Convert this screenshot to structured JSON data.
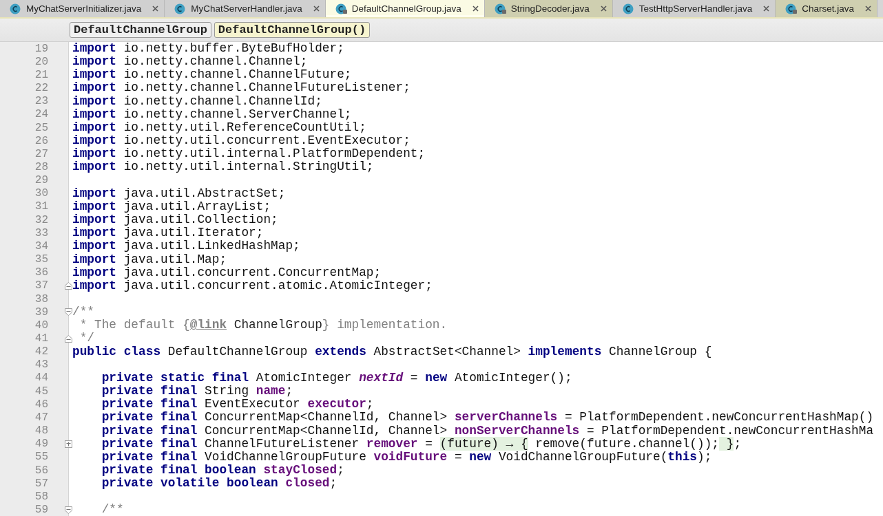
{
  "tabs": [
    {
      "label": "MyChatServerInitializer.java",
      "selected": false,
      "kind": "class",
      "color": "#d0d0d0"
    },
    {
      "label": "MyChatServerHandler.java",
      "selected": false,
      "kind": "class",
      "color": "#d0d0d0"
    },
    {
      "label": "DefaultChannelGroup.java",
      "selected": true,
      "kind": "class-locked",
      "color": "#fbfbe4"
    },
    {
      "label": "StringDecoder.java",
      "selected": false,
      "kind": "class-locked",
      "color": "#cfcfb0"
    },
    {
      "label": "TestHttpServerHandler.java",
      "selected": false,
      "kind": "class",
      "color": "#d0d0d0"
    },
    {
      "label": "Charset.java",
      "selected": false,
      "kind": "class-locked",
      "color": "#cfcfb0"
    }
  ],
  "breadcrumbs": [
    {
      "label": "DefaultChannelGroup",
      "selected": false
    },
    {
      "label": "DefaultChannelGroup()",
      "selected": true
    }
  ],
  "lines": [
    {
      "number": "19",
      "tokens": [
        {
          "kind": "keyword",
          "text": "import"
        },
        {
          "kind": "plain",
          "text": " io.netty.buffer.ByteBufHolder;"
        }
      ]
    },
    {
      "number": "20",
      "tokens": [
        {
          "kind": "keyword",
          "text": "import"
        },
        {
          "kind": "plain",
          "text": " io.netty.channel.Channel;"
        }
      ]
    },
    {
      "number": "21",
      "tokens": [
        {
          "kind": "keyword",
          "text": "import"
        },
        {
          "kind": "plain",
          "text": " io.netty.channel.ChannelFuture;"
        }
      ]
    },
    {
      "number": "22",
      "tokens": [
        {
          "kind": "keyword",
          "text": "import"
        },
        {
          "kind": "plain",
          "text": " io.netty.channel.ChannelFutureListener;"
        }
      ]
    },
    {
      "number": "23",
      "tokens": [
        {
          "kind": "keyword",
          "text": "import"
        },
        {
          "kind": "plain",
          "text": " io.netty.channel.ChannelId;"
        }
      ]
    },
    {
      "number": "24",
      "tokens": [
        {
          "kind": "keyword",
          "text": "import"
        },
        {
          "kind": "plain",
          "text": " io.netty.channel.ServerChannel;"
        }
      ]
    },
    {
      "number": "25",
      "tokens": [
        {
          "kind": "keyword",
          "text": "import"
        },
        {
          "kind": "plain",
          "text": " io.netty.util.ReferenceCountUtil;"
        }
      ]
    },
    {
      "number": "26",
      "tokens": [
        {
          "kind": "keyword",
          "text": "import"
        },
        {
          "kind": "plain",
          "text": " io.netty.util.concurrent.EventExecutor;"
        }
      ]
    },
    {
      "number": "27",
      "tokens": [
        {
          "kind": "keyword",
          "text": "import"
        },
        {
          "kind": "plain",
          "text": " io.netty.util.internal.PlatformDependent;"
        }
      ]
    },
    {
      "number": "28",
      "tokens": [
        {
          "kind": "keyword",
          "text": "import"
        },
        {
          "kind": "plain",
          "text": " io.netty.util.internal.StringUtil;"
        }
      ]
    },
    {
      "number": "29"
    },
    {
      "number": "30",
      "tokens": [
        {
          "kind": "keyword",
          "text": "import"
        },
        {
          "kind": "plain",
          "text": " java.util.AbstractSet;"
        }
      ]
    },
    {
      "number": "31",
      "tokens": [
        {
          "kind": "keyword",
          "text": "import"
        },
        {
          "kind": "plain",
          "text": " java.util.ArrayList;"
        }
      ]
    },
    {
      "number": "32",
      "tokens": [
        {
          "kind": "keyword",
          "text": "import"
        },
        {
          "kind": "plain",
          "text": " java.util.Collection;"
        }
      ]
    },
    {
      "number": "33",
      "tokens": [
        {
          "kind": "keyword",
          "text": "import"
        },
        {
          "kind": "plain",
          "text": " java.util.Iterator;"
        }
      ]
    },
    {
      "number": "34",
      "tokens": [
        {
          "kind": "keyword",
          "text": "import"
        },
        {
          "kind": "plain",
          "text": " java.util.LinkedHashMap;"
        }
      ]
    },
    {
      "number": "35",
      "tokens": [
        {
          "kind": "keyword",
          "text": "import"
        },
        {
          "kind": "plain",
          "text": " java.util.Map;"
        }
      ]
    },
    {
      "number": "36",
      "tokens": [
        {
          "kind": "keyword",
          "text": "import"
        },
        {
          "kind": "plain",
          "text": " java.util.concurrent.ConcurrentMap;"
        }
      ]
    },
    {
      "number": "37",
      "fold_end": true,
      "tokens": [
        {
          "kind": "keyword",
          "text": "import"
        },
        {
          "kind": "plain",
          "text": " java.util.concurrent.atomic.AtomicInteger;"
        }
      ]
    },
    {
      "number": "38"
    },
    {
      "number": "39",
      "fold_start": true,
      "tokens": [
        {
          "kind": "comment",
          "text": "/**"
        }
      ]
    },
    {
      "number": "40",
      "tokens": [
        {
          "kind": "comment",
          "text": " * The default {"
        },
        {
          "kind": "doc-tag",
          "text": "@link"
        },
        {
          "kind": "doc-ref",
          "text": " ChannelGroup"
        },
        {
          "kind": "comment",
          "text": "} implementation."
        }
      ]
    },
    {
      "number": "41",
      "fold_end": true,
      "tokens": [
        {
          "kind": "comment",
          "text": " */"
        }
      ]
    },
    {
      "number": "42",
      "tokens": [
        {
          "kind": "keyword",
          "text": "public class"
        },
        {
          "kind": "plain",
          "text": " DefaultChannelGroup "
        },
        {
          "kind": "keyword",
          "text": "extends"
        },
        {
          "kind": "plain",
          "text": " AbstractSet<Channel> "
        },
        {
          "kind": "keyword",
          "text": "implements"
        },
        {
          "kind": "plain",
          "text": " ChannelGroup {"
        }
      ]
    },
    {
      "number": "43"
    },
    {
      "number": "44",
      "indented": true,
      "tokens": [
        {
          "kind": "keyword",
          "text": "private static final"
        },
        {
          "kind": "plain",
          "text": " AtomicInteger "
        },
        {
          "kind": "static-field",
          "text": "nextId"
        },
        {
          "kind": "plain",
          "text": " = "
        },
        {
          "kind": "keyword",
          "text": "new"
        },
        {
          "kind": "plain",
          "text": " AtomicInteger();"
        }
      ]
    },
    {
      "number": "45",
      "indented": true,
      "tokens": [
        {
          "kind": "keyword",
          "text": "private final"
        },
        {
          "kind": "plain",
          "text": " String "
        },
        {
          "kind": "field",
          "text": "name"
        },
        {
          "kind": "plain",
          "text": ";"
        }
      ]
    },
    {
      "number": "46",
      "indented": true,
      "tokens": [
        {
          "kind": "keyword",
          "text": "private final"
        },
        {
          "kind": "plain",
          "text": " EventExecutor "
        },
        {
          "kind": "field",
          "text": "executor"
        },
        {
          "kind": "plain",
          "text": ";"
        }
      ]
    },
    {
      "number": "47",
      "indented": true,
      "tokens": [
        {
          "kind": "keyword",
          "text": "private final"
        },
        {
          "kind": "plain",
          "text": " ConcurrentMap<ChannelId, Channel> "
        },
        {
          "kind": "field",
          "text": "serverChannels"
        },
        {
          "kind": "plain",
          "text": " = PlatformDependent.newConcurrentHashMap()"
        }
      ]
    },
    {
      "number": "48",
      "indented": true,
      "tokens": [
        {
          "kind": "keyword",
          "text": "private final"
        },
        {
          "kind": "plain",
          "text": " ConcurrentMap<ChannelId, Channel> "
        },
        {
          "kind": "field",
          "text": "nonServerChannels"
        },
        {
          "kind": "plain",
          "text": " = PlatformDependent.newConcurrentHashMa"
        }
      ]
    },
    {
      "number": "49",
      "collapsed": true,
      "indented": true,
      "tokens": [
        {
          "kind": "keyword",
          "text": "private final"
        },
        {
          "kind": "plain",
          "text": " ChannelFutureListener "
        },
        {
          "kind": "field",
          "text": "remover"
        },
        {
          "kind": "plain",
          "text": " = "
        },
        {
          "kind": "folded",
          "text": "(future) → {"
        },
        {
          "kind": "plain",
          "text": " remove(future.channel());"
        },
        {
          "kind": "folded",
          "text": " }"
        },
        {
          "kind": "plain",
          "text": ";"
        }
      ]
    },
    {
      "number": "55",
      "indented": true,
      "tokens": [
        {
          "kind": "keyword",
          "text": "private final"
        },
        {
          "kind": "plain",
          "text": " VoidChannelGroupFuture "
        },
        {
          "kind": "field",
          "text": "voidFuture"
        },
        {
          "kind": "plain",
          "text": " = "
        },
        {
          "kind": "keyword",
          "text": "new"
        },
        {
          "kind": "plain",
          "text": " VoidChannelGroupFuture("
        },
        {
          "kind": "keyword",
          "text": "this"
        },
        {
          "kind": "plain",
          "text": ");"
        }
      ]
    },
    {
      "number": "56",
      "indented": true,
      "tokens": [
        {
          "kind": "keyword",
          "text": "private final boolean"
        },
        {
          "kind": "field",
          "text": " stayClosed"
        },
        {
          "kind": "plain",
          "text": ";"
        }
      ]
    },
    {
      "number": "57",
      "indented": true,
      "tokens": [
        {
          "kind": "keyword",
          "text": "private volatile boolean"
        },
        {
          "kind": "field",
          "text": " closed"
        },
        {
          "kind": "plain",
          "text": ";"
        }
      ]
    },
    {
      "number": "58"
    },
    {
      "number": "59",
      "fold_start": true,
      "indented": true,
      "tokens": [
        {
          "kind": "comment",
          "text": "/**"
        }
      ]
    }
  ]
}
